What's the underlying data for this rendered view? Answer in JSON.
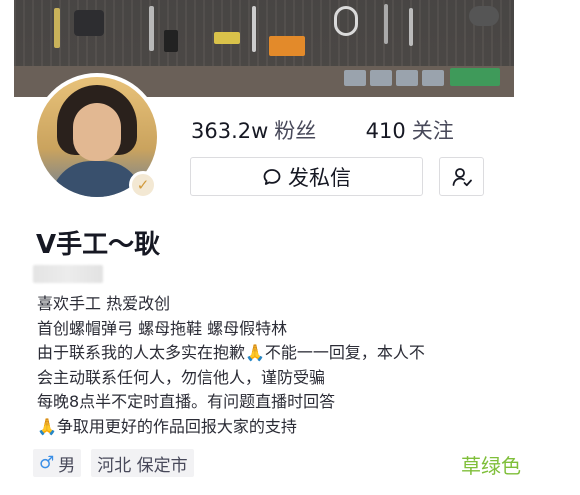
{
  "profile": {
    "followers_count": "363.2w",
    "followers_label": "粉丝",
    "following_count": "410",
    "following_label": "关注",
    "message_button": "发私信",
    "name": "V手工～耿",
    "bio_lines": [
      "喜欢手工   热爱改创",
      "首创螺帽弹弓  螺母拖鞋  螺母假特林",
      "由于联系我的人太多实在抱歉🙏不能一一回复，本人不",
      "会主动联系任何人，勿信他人，谨防受骗",
      "每晚8点半不定时直播。有问题直播时回答",
      "🙏争取用更好的作品回报大家的支持"
    ],
    "gender_symbol": "♂",
    "gender_label": "男",
    "location": "河北 保定市"
  },
  "watermark": "草绿色",
  "colors": {
    "accent_verify": "#d19a3c",
    "male": "#3a8ee6",
    "watermark": "#7fbf3a"
  },
  "icons": {
    "message": "chat-bubble-icon",
    "follow": "user-check-icon",
    "verified": "verified-badge-icon"
  }
}
